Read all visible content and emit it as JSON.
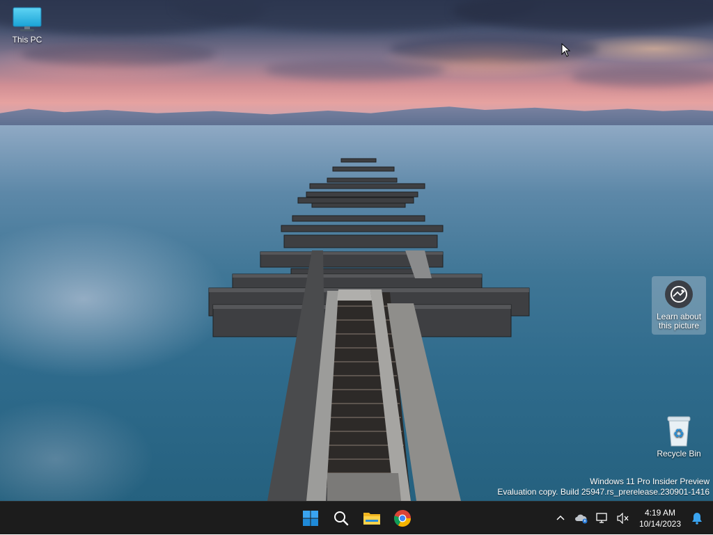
{
  "desktop": {
    "icons": [
      {
        "label": "This PC",
        "icon": "this-pc-icon"
      },
      {
        "label": "Recycle Bin",
        "icon": "recycle-bin-icon"
      }
    ],
    "learn_widget": {
      "label": "Learn about this picture",
      "icon": "camera-lens-icon"
    },
    "watermark": {
      "line1": "Windows 11 Pro Insider Preview",
      "line2": "Evaluation copy. Build 25947.rs_prerelease.230901-1416"
    }
  },
  "taskbar": {
    "apps": [
      {
        "name": "Start",
        "icon": "windows-start-icon"
      },
      {
        "name": "Search",
        "icon": "search-icon"
      },
      {
        "name": "File Explorer",
        "icon": "file-explorer-icon"
      },
      {
        "name": "Google Chrome",
        "icon": "chrome-icon"
      }
    ],
    "tray": {
      "icons": [
        "chevron-up-icon",
        "onedrive-icon",
        "network-icon",
        "volume-muted-icon"
      ],
      "time": "4:19 AM",
      "date": "10/14/2023",
      "notification_icon": "bell-icon"
    },
    "colors": {
      "background": "#1c1c1c",
      "accent": "#0078d4"
    }
  }
}
